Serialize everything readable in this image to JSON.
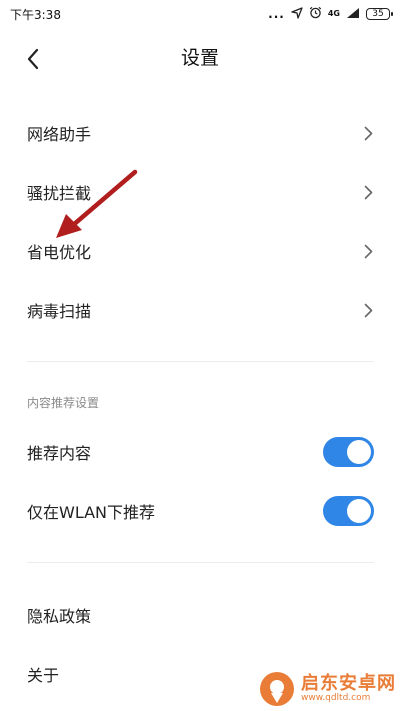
{
  "status_bar": {
    "time": "下午3:38",
    "more": "...",
    "network": "4G",
    "battery": "35",
    "icons": [
      "location-icon",
      "alarm-icon",
      "signal-icon",
      "battery-icon"
    ]
  },
  "header": {
    "title": "设置",
    "back_icon": "chevron-left-icon"
  },
  "menu": {
    "items": [
      {
        "label": "网络助手",
        "icon": "chevron-right-icon"
      },
      {
        "label": "骚扰拦截",
        "icon": "chevron-right-icon"
      },
      {
        "label": "省电优化",
        "icon": "chevron-right-icon"
      },
      {
        "label": "病毒扫描",
        "icon": "chevron-right-icon"
      }
    ]
  },
  "content_section": {
    "header": "内容推荐设置",
    "toggles": [
      {
        "label": "推荐内容",
        "on": true
      },
      {
        "label": "仅在WLAN下推荐",
        "on": true
      }
    ]
  },
  "footer_items": [
    {
      "label": "隐私政策"
    },
    {
      "label": "关于"
    }
  ],
  "annotation": {
    "type": "arrow",
    "color": "#b01e1e",
    "target": "省电优化"
  },
  "watermark": {
    "text_cn": "启东安卓网",
    "text_en": "www.qdltd.com"
  },
  "colors": {
    "toggle_on": "#2f86e6",
    "background": "#ffffff",
    "section_header": "#8a8a8a",
    "divider": "#ededed"
  }
}
